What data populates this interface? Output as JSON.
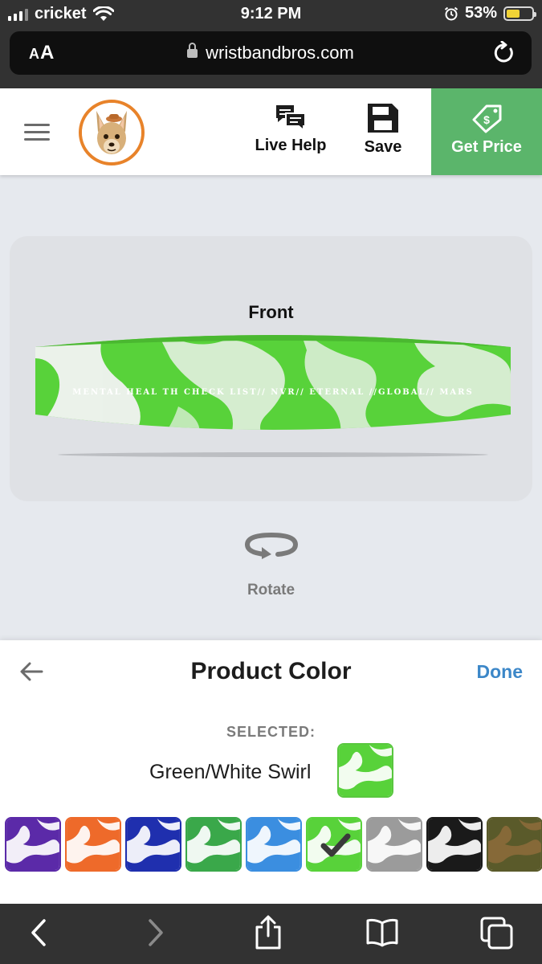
{
  "status_bar": {
    "carrier": "cricket",
    "time": "9:12 PM",
    "battery": "53%",
    "battery_level": 0.53
  },
  "browser": {
    "text_size_label_small": "A",
    "text_size_label_large": "A",
    "url": "wristbandbros.com",
    "icons": [
      "lock-icon",
      "reload-icon"
    ]
  },
  "header": {
    "live_help_label": "Live Help",
    "save_label": "Save",
    "get_price_label": "Get Price",
    "icons": [
      "hamburger-menu-icon",
      "chihuahua-logo",
      "chat-bubbles-icon",
      "floppy-disk-icon",
      "price-tag-icon"
    ]
  },
  "preview": {
    "view_label": "Front",
    "band_text": "MENTAL HEAL TH CHECK LIST// NVR// ETERNAL //GLOBAL// MARS",
    "rotate_label": "Rotate"
  },
  "product_color": {
    "title": "Product Color",
    "done_label": "Done",
    "selected_label": "SELECTED:",
    "selected_name": "Green/White Swirl",
    "swatches": [
      {
        "name": "purple-white-swirl",
        "base": "#5b2aa8",
        "swirl": "#ffffff",
        "border": "#5b2aa8",
        "selected": false
      },
      {
        "name": "orange-white-swirl",
        "base": "#ee6a2a",
        "swirl": "#ffffff",
        "border": "#ee6a2a",
        "selected": false
      },
      {
        "name": "blue-white-swirl",
        "base": "#1f2fae",
        "swirl": "#ffffff",
        "border": "#1f2fae",
        "selected": false
      },
      {
        "name": "green-white-swirl-dark",
        "base": "#3aa84a",
        "swirl": "#ffffff",
        "border": "#3aa84a",
        "selected": false
      },
      {
        "name": "lightblue-white-swirl",
        "base": "#3b8ee0",
        "swirl": "#ffffff",
        "border": "#3b8ee0",
        "selected": false
      },
      {
        "name": "green-white-swirl",
        "base": "#58d23a",
        "swirl": "#ffffff",
        "border": "#58d23a",
        "selected": true
      },
      {
        "name": "gray-white-swirl",
        "base": "#9b9b9b",
        "swirl": "#ffffff",
        "border": "#9b9b9b",
        "selected": false
      },
      {
        "name": "black-white-swirl",
        "base": "#1a1a1a",
        "swirl": "#ffffff",
        "border": "#1a1a1a",
        "selected": false
      },
      {
        "name": "camo",
        "base": "#5a5a2a",
        "swirl": "#8a6a3a",
        "border": "#5a5a2a",
        "selected": false
      }
    ]
  },
  "colors": {
    "accent_green": "#5bb56b",
    "done_blue": "#3c87c8",
    "band_green": "#58d23a"
  },
  "toolbar": {
    "icons": [
      "back-icon",
      "forward-icon",
      "share-icon",
      "bookmarks-icon",
      "tabs-icon"
    ]
  }
}
